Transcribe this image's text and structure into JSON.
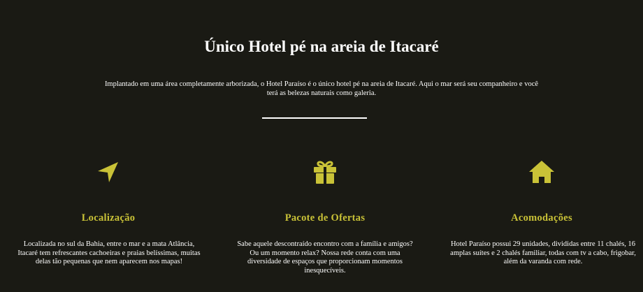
{
  "hero": {
    "title": "Único Hotel pé na areia de Itacaré",
    "description": "Implantado em uma área completamente arborizada, o Hotel Paraíso é o único hotel pé na areia de Itacaré. Aqui o mar será seu companheiro e você terá as belezas naturais como galeria."
  },
  "colors": {
    "background": "#1a1a14",
    "accent": "#c9c237",
    "text": "#ffffff"
  },
  "features": [
    {
      "icon": "location-arrow-icon",
      "title": "Localização",
      "text": "Localizada no sul da Bahia, entre o mar e a mata Atlância, Itacaré tem refrescantes cachoeiras e praias belíssimas, muitas delas tão pequenas que nem aparecem nos mapas!"
    },
    {
      "icon": "gift-icon",
      "title": "Pacote de Ofertas",
      "text": "Sabe aquele descontraído encontro com a família e amigos? Ou um momento relax? Nossa rede conta com uma diversidade de espaços que proporcionam momentos inesquecíveis."
    },
    {
      "icon": "home-icon",
      "title": "Acomodações",
      "text": "Hotel Paraíso possui 29 unidades, divididas entre 11 chalés, 16 amplas suítes e 2 chalés familiar, todas com tv a cabo, frigobar, além da varanda com rede."
    }
  ]
}
